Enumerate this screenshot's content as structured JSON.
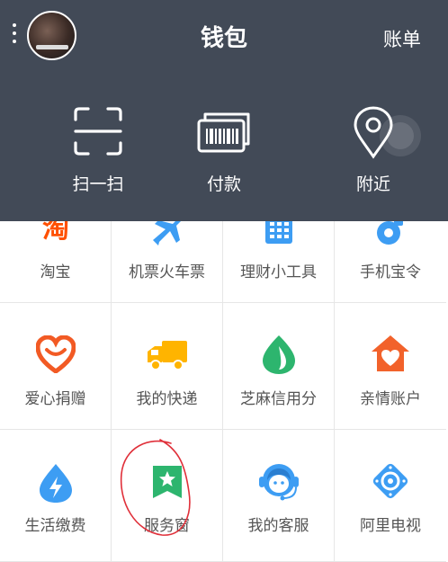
{
  "header": {
    "title": "钱包",
    "bill_label": "账单",
    "actions": [
      {
        "label": "扫一扫",
        "icon": "scan-icon"
      },
      {
        "label": "付款",
        "icon": "pay-barcode-icon"
      },
      {
        "label": "附近",
        "icon": "location-pin-icon"
      }
    ]
  },
  "grid": {
    "rows": [
      [
        {
          "label": "淘宝",
          "icon": "taobao-icon",
          "color": "#ff5000"
        },
        {
          "label": "机票火车票",
          "icon": "airplane-icon",
          "color": "#3d9df3"
        },
        {
          "label": "理财小工具",
          "icon": "calculator-icon",
          "color": "#3d9df3"
        },
        {
          "label": "手机宝令",
          "icon": "token-icon",
          "color": "#3d9df3"
        }
      ],
      [
        {
          "label": "爱心捐赠",
          "icon": "heart-icon",
          "color": "#f25a24"
        },
        {
          "label": "我的快递",
          "icon": "truck-icon",
          "color": "#ffb400"
        },
        {
          "label": "芝麻信用分",
          "icon": "sesame-credit-icon",
          "color": "#2db56e"
        },
        {
          "label": "亲情账户",
          "icon": "family-home-icon",
          "color": "#f2622b"
        }
      ],
      [
        {
          "label": "生活缴费",
          "icon": "water-drop-bolt-icon",
          "color": "#3d9df3"
        },
        {
          "label": "服务窗",
          "icon": "service-window-icon",
          "color": "#2db56e"
        },
        {
          "label": "我的客服",
          "icon": "customer-service-icon",
          "color": "#3d9df3"
        },
        {
          "label": "阿里电视",
          "icon": "tv-remote-icon",
          "color": "#3d9df3"
        }
      ]
    ]
  }
}
